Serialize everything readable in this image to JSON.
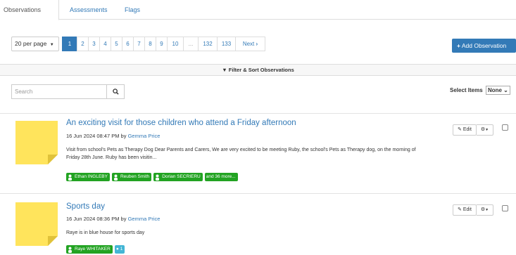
{
  "tabs": [
    {
      "label": "Observations",
      "active": true
    },
    {
      "label": "Assessments",
      "active": false
    },
    {
      "label": "Flags",
      "active": false
    }
  ],
  "toolbar": {
    "per_page": "20 per page",
    "pages": [
      "1",
      "2",
      "3",
      "4",
      "5",
      "6",
      "7",
      "8",
      "9",
      "10",
      "...",
      "132",
      "133"
    ],
    "active_page": "1",
    "next_label": "Next",
    "add_label": "Add Observation"
  },
  "filter": {
    "label": "Filter & Sort Observations"
  },
  "search": {
    "placeholder": "Search"
  },
  "select_items": {
    "label": "Select Items",
    "value": "None"
  },
  "observations": [
    {
      "title": "An exciting visit for those children who attend a Friday afternoon",
      "date": "16 Jun 2024 08:47 PM by",
      "author": "Gemma Price",
      "description": "Visit from school's Pets as Therapy Dog Dear Parents and Carers, We are very excited to be meeting Ruby, the school's Pets as Therapy dog, on the morning of Friday 28th June. Ruby has been visitin...",
      "tags": [
        "Ethan INGLEBY",
        "Reuben Smith",
        "Dorian SECRIERU"
      ],
      "more": "and 36 more...",
      "edit_label": "Edit"
    },
    {
      "title": "Sports day",
      "date": "16 Jun 2024 08:36 PM by",
      "author": "Gemma Price",
      "description": "Raye is in blue house for sports day",
      "tags": [
        "Raye WHITAKER"
      ],
      "comments": "1",
      "edit_label": "Edit"
    }
  ],
  "colors": {
    "primary": "#337ab7",
    "tag_green": "#22a322",
    "comment_blue": "#44b6d5",
    "sticky_yellow": "#ffe45c"
  }
}
